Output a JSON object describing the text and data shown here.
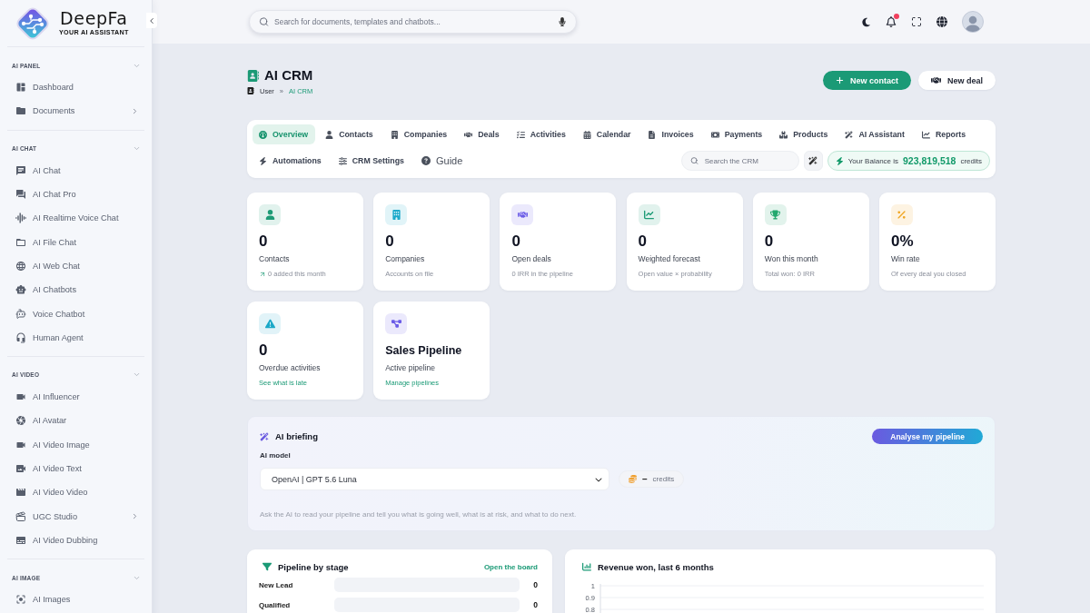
{
  "sidebar": {
    "logo": {
      "name": "DeepFa",
      "tagline": "YOUR AI ASSISTANT"
    },
    "sections": [
      {
        "title": "AI PANEL",
        "expanded": true,
        "items": [
          {
            "label": "Dashboard",
            "kind": "link"
          },
          {
            "label": "Documents",
            "kind": "submenu"
          }
        ]
      },
      {
        "title": "AI CHAT",
        "expanded": true,
        "items": [
          {
            "label": "AI Chat",
            "kind": "link"
          },
          {
            "label": "AI Chat Pro",
            "kind": "link"
          },
          {
            "label": "AI Realtime Voice Chat",
            "kind": "link"
          },
          {
            "label": "AI File Chat",
            "kind": "link"
          },
          {
            "label": "AI Web Chat",
            "kind": "link"
          },
          {
            "label": "AI Chatbots",
            "kind": "link"
          },
          {
            "label": "Voice Chatbot",
            "kind": "link"
          },
          {
            "label": "Human Agent",
            "kind": "link"
          }
        ]
      },
      {
        "title": "AI VIDEO",
        "expanded": true,
        "items": [
          {
            "label": "AI Influencer",
            "kind": "link"
          },
          {
            "label": "AI Avatar",
            "kind": "link"
          },
          {
            "label": "AI Video Image",
            "kind": "link"
          },
          {
            "label": "AI Video Text",
            "kind": "link"
          },
          {
            "label": "AI Video Video",
            "kind": "link"
          },
          {
            "label": "UGC Studio",
            "kind": "submenu"
          },
          {
            "label": "AI Video Dubbing",
            "kind": "link"
          }
        ]
      },
      {
        "title": "AI IMAGE",
        "expanded": true,
        "items": [
          {
            "label": "AI Images",
            "kind": "link"
          }
        ]
      }
    ]
  },
  "topbar": {
    "search": {
      "placeholder": "Search for documents, templates and chatbots..."
    },
    "notifications_unread": true
  },
  "page": {
    "title": "AI CRM",
    "breadcrumb": [
      {
        "label": "User",
        "current": false
      },
      {
        "label": "AI CRM",
        "current": true
      }
    ],
    "separator": "»",
    "actions": [
      {
        "label": "New contact",
        "kind": "primary"
      },
      {
        "label": "New deal",
        "kind": "secondary"
      }
    ]
  },
  "tab_bar": {
    "rows": [
      {
        "tabs": [
          {
            "label": "Overview",
            "selected": true,
            "kind": "tab"
          },
          {
            "label": "Contacts",
            "selected": false,
            "kind": "tab"
          },
          {
            "label": "Companies",
            "selected": false,
            "kind": "tab"
          },
          {
            "label": "Deals",
            "selected": false,
            "kind": "tab"
          },
          {
            "label": "Activities",
            "selected": false,
            "kind": "tab"
          },
          {
            "label": "Calendar",
            "selected": false,
            "kind": "tab"
          },
          {
            "label": "Invoices",
            "selected": false,
            "kind": "tab"
          },
          {
            "label": "Payments",
            "selected": false,
            "kind": "tab"
          },
          {
            "label": "Products",
            "selected": false,
            "kind": "tab"
          },
          {
            "label": "AI Assistant",
            "selected": false,
            "kind": "tab"
          },
          {
            "label": "Reports",
            "selected": false,
            "kind": "tab"
          }
        ]
      },
      {
        "tabs": [
          {
            "label": "Automations",
            "selected": false,
            "kind": "tab"
          },
          {
            "label": "CRM Settings",
            "selected": false,
            "kind": "tab"
          },
          {
            "label": "Guide",
            "selected": false,
            "kind": "help"
          }
        ]
      }
    ],
    "search": {
      "placeholder": "Search the CRM"
    },
    "balance": {
      "label": "Your Balance is",
      "amount": "923,819,518",
      "unit": "credits"
    }
  },
  "stats": [
    {
      "value": "0",
      "label": "Contacts",
      "note": {
        "text": "0 added this month",
        "kind": "trend"
      },
      "color": "#1d9b76",
      "kind": "metric"
    },
    {
      "value": "0",
      "label": "Companies",
      "note": {
        "text": "Accounts on file",
        "kind": "plain"
      },
      "color": "#1eaacb",
      "kind": "metric"
    },
    {
      "value": "0",
      "label": "Open deals",
      "note": {
        "text": "0 IRR in the pipeline",
        "kind": "plain"
      },
      "color": "#6b5ce7",
      "kind": "metric"
    },
    {
      "value": "0",
      "label": "Weighted forecast",
      "note": {
        "text": "Open value × probability",
        "kind": "plain"
      },
      "color": "#1d9b76",
      "kind": "metric"
    },
    {
      "value": "0",
      "label": "Won this month",
      "note": {
        "text": "Total won: 0 IRR",
        "kind": "plain"
      },
      "color": "#22a86e",
      "kind": "metric"
    },
    {
      "value": "0%",
      "label": "Win rate",
      "note": {
        "text": "Of every deal you closed",
        "kind": "plain"
      },
      "color": "#f0a623",
      "kind": "metric"
    },
    {
      "value": "0",
      "label": "Overdue activities",
      "note": {
        "text": "See what is late",
        "kind": "link"
      },
      "color": "#1ba8c8",
      "kind": "metric"
    },
    {
      "value": "Sales Pipeline",
      "label": "Active pipeline",
      "note": {
        "text": "Manage pipelines",
        "kind": "link"
      },
      "color": "#6b5ce7",
      "kind": "title"
    }
  ],
  "briefing": {
    "title": "AI briefing",
    "action": "Analyse my pipeline",
    "model_label": "AI model",
    "model": "OpenAI | GPT 5.6 Luna",
    "cost": "–",
    "cost_unit": "credits",
    "hint": "Ask the AI to read your pipeline and tell you what is going well, what is at risk, and what to do next."
  },
  "pipeline": {
    "title": "Pipeline by stage",
    "link": "Open the board",
    "stages": [
      {
        "name": "New Lead",
        "level": 0,
        "count": "0"
      },
      {
        "name": "Qualified",
        "level": 0,
        "count": "0"
      }
    ]
  },
  "revenue": {
    "title": "Revenue won, last 6 months",
    "y_axis_labels": [
      "1",
      "0.9",
      "0.8"
    ]
  }
}
